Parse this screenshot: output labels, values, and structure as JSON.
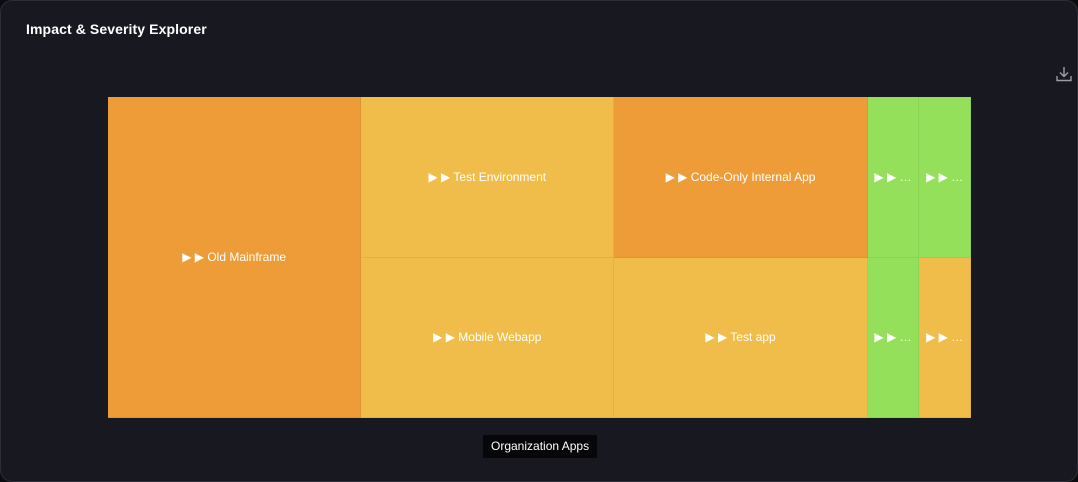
{
  "header": {
    "title": "Impact & Severity Explorer"
  },
  "toolbar": {
    "download_icon": "download-icon"
  },
  "breadcrumb": {
    "label": "Organization Apps"
  },
  "colors": {
    "orange": "#ee9c38",
    "yellow": "#f1bd4a",
    "green": "#95e05a",
    "panel": "#181920"
  },
  "chart_data": {
    "type": "treemap",
    "title": "Impact & Severity Explorer",
    "root": "Organization Apps",
    "expand_marker": "▶ ▶",
    "items": [
      {
        "label": "Old Mainframe",
        "value": 29.4,
        "color": "#ee9c38"
      },
      {
        "label": "Test Environment",
        "value": 14.7,
        "color": "#f1bd4a"
      },
      {
        "label": "Mobile Webapp",
        "value": 14.7,
        "color": "#f1bd4a"
      },
      {
        "label": "Code-Only Internal App",
        "value": 14.7,
        "color": "#ee9c38"
      },
      {
        "label": "Test app",
        "value": 14.7,
        "color": "#f1bd4a"
      },
      {
        "label": "…",
        "value": 3.0,
        "color": "#95e05a"
      },
      {
        "label": "…",
        "value": 3.0,
        "color": "#95e05a"
      },
      {
        "label": "…",
        "value": 3.0,
        "color": "#95e05a"
      },
      {
        "label": "…",
        "value": 3.0,
        "color": "#f1bd4a"
      }
    ]
  }
}
